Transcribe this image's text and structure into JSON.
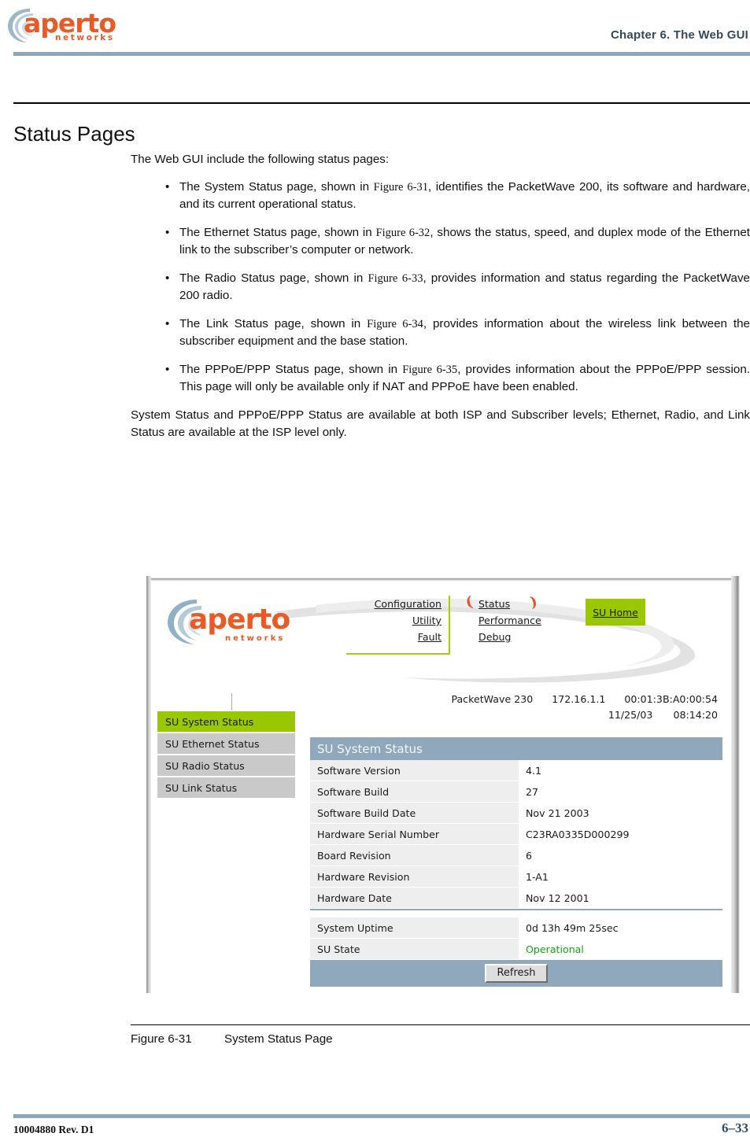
{
  "header": {
    "logo_word": "aperto",
    "logo_subword": "networks",
    "chapter_title": "Chapter 6.  The Web GUI"
  },
  "section": {
    "title": "Status Pages"
  },
  "body": {
    "intro": "The Web GUI include the following status pages:",
    "bullets": [
      {
        "pre": "The System Status page, shown in ",
        "figref": "Figure 6-31",
        "post": ", identifies the PacketWave 200, its software and hardware, and its current operational status."
      },
      {
        "pre": "The Ethernet Status page, shown in ",
        "figref": "Figure 6-32",
        "post": ", shows the status, speed, and duplex mode of the Ethernet link to the subscriber’s computer or network."
      },
      {
        "pre": "The Radio Status page, shown in ",
        "figref": "Figure 6-33",
        "post": ", provides information and status regarding the PacketWave 200 radio."
      },
      {
        "pre": "The Link Status page, shown in ",
        "figref": "Figure 6-34",
        "post": ", provides information about the wireless link between the subscriber equipment and the base station."
      },
      {
        "pre": "The PPPoE/PPP Status page, shown in ",
        "figref": "Figure 6-35",
        "post": ", provides information about the PPPoE/PPP session. This page will only be available only if NAT and PPPoE have been enabled."
      }
    ],
    "closing": "System Status and PPPoE/PPP Status are available at both ISP and Subscriber levels; Ethernet, Radio, and Link Status are available at the ISP level only."
  },
  "figure": {
    "caption_number": "Figure 6-31",
    "caption_text": "System Status Page",
    "gui": {
      "logo_word": "aperto",
      "logo_subword": "networks",
      "nav_left": [
        {
          "label": "Configuration"
        },
        {
          "label": "Utility"
        },
        {
          "label": "Fault"
        }
      ],
      "nav_right": [
        {
          "label": "Status",
          "active": true
        },
        {
          "label": "Performance",
          "active": false
        },
        {
          "label": "Debug",
          "active": false
        }
      ],
      "su_home_label": "SU Home",
      "device_info": {
        "model": "PacketWave 230",
        "ip_address": "172.16.1.1",
        "mac_address": "00:01:3B:A0:00:54",
        "date": "11/25/03",
        "time": "08:14:20"
      },
      "sidebar": [
        {
          "label": "SU System Status",
          "active": true
        },
        {
          "label": "SU Ethernet Status",
          "active": false
        },
        {
          "label": "SU Radio Status",
          "active": false
        },
        {
          "label": "SU Link Status",
          "active": false
        }
      ],
      "table": {
        "title": "SU System Status",
        "rows": [
          {
            "label": "Software Version",
            "value": "4.1"
          },
          {
            "label": "Software Build",
            "value": "27"
          },
          {
            "label": "Software Build Date",
            "value": "Nov 21 2003"
          },
          {
            "label": "Hardware Serial Number",
            "value": "C23RA0335D000299"
          },
          {
            "label": "Board Revision",
            "value": "6"
          },
          {
            "label": "Hardware Revision",
            "value": "1-A1"
          },
          {
            "label": "Hardware Date",
            "value": "Nov 12 2001"
          }
        ],
        "rows_after_divider": [
          {
            "label": "System Uptime",
            "value": "0d 13h 49m 25sec"
          },
          {
            "label": "SU State",
            "value": "Operational",
            "value_color": "#12a512"
          }
        ],
        "refresh_label": "Refresh"
      }
    }
  },
  "footer": {
    "doc_id": "10004880 Rev. D1",
    "page_number": "6–33"
  },
  "colors": {
    "rule_blue": "#8fa6b8",
    "accent_orange": "#ea5a24",
    "accent_green": "#9ac800",
    "nav_border_green": "#a4d000",
    "table_header_blue": "#8fa8bc",
    "sidebar_gray": "#c9c9c9",
    "status_green": "#12a512"
  }
}
